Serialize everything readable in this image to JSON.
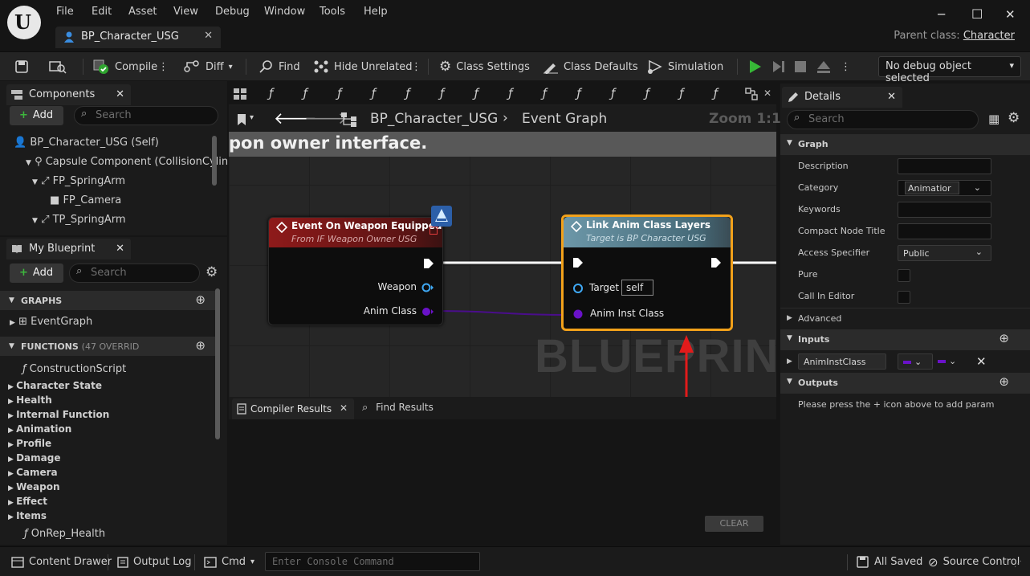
{
  "app": {
    "logo_letter": "U",
    "menu": [
      "File",
      "Edit",
      "Asset",
      "View",
      "Debug",
      "Window",
      "Tools",
      "Help"
    ],
    "tab_title": "BP_Character_USG",
    "parent_class_label": "Parent class:",
    "parent_class_value": "Character"
  },
  "toolbar": {
    "compile": "Compile",
    "diff": "Diff",
    "find": "Find",
    "hide_unrelated": "Hide Unrelated",
    "class_settings": "Class Settings",
    "class_defaults": "Class Defaults",
    "simulation": "Simulation",
    "debug_object": "No debug object selected"
  },
  "components": {
    "title": "Components",
    "add": "Add",
    "search_placeholder": "Search",
    "items": [
      "BP_Character_USG (Self)",
      "Capsule Component (CollisionCylin",
      "FP_SpringArm",
      "FP_Camera",
      "TP_SpringArm"
    ]
  },
  "my_blueprint": {
    "title": "My Blueprint",
    "add": "Add",
    "search_placeholder": "Search",
    "graphs_label": "GRAPHS",
    "event_graph": "EventGraph",
    "functions_label": "FUNCTIONS",
    "functions_overrides": "(47 OVERRID",
    "construction_script": "ConstructionScript",
    "categories": [
      "Character State",
      "Health",
      "Internal Function",
      "Animation",
      "Profile",
      "Damage",
      "Camera",
      "Weapon",
      "Effect",
      "Items"
    ],
    "last_item": "OnRep_Health"
  },
  "graph": {
    "func_glyph": "ƒ",
    "breadcrumb_bp": "BP_Character_USG",
    "breadcrumb_graph": "Event Graph",
    "zoom": "Zoom 1:1",
    "comment": "pon owner interface.",
    "watermark": "BLUEPRINT",
    "node1": {
      "title": "Event On Weapon Equipped",
      "subtitle": "From IF Weapon Owner USG",
      "pin_weapon": "Weapon",
      "pin_anim_class": "Anim Class"
    },
    "node2": {
      "title": "Link Anim Class Layers",
      "subtitle": "Target is BP Character USG",
      "pin_target": "Target",
      "pin_target_value": "self",
      "pin_anim_inst": "Anim Inst Class"
    }
  },
  "results": {
    "tab_compiler": "Compiler Results",
    "tab_find": "Find Results",
    "clear": "CLEAR"
  },
  "details": {
    "title": "Details",
    "search_placeholder": "Search",
    "graph_section": "Graph",
    "rows": {
      "description": "Description",
      "category": "Category",
      "category_value": "Animatior",
      "keywords": "Keywords",
      "compact": "Compact Node Title",
      "access": "Access Specifier",
      "access_value": "Public",
      "pure": "Pure",
      "call_in_editor": "Call In Editor"
    },
    "advanced": "Advanced",
    "inputs": "Inputs",
    "input_name": "AnimInstClass",
    "outputs": "Outputs",
    "outputs_hint": "Please press the + icon above to add parameters"
  },
  "statusbar": {
    "content_drawer": "Content Drawer",
    "output_log": "Output Log",
    "cmd": "Cmd",
    "console_placeholder": "Enter Console Command",
    "all_saved": "All Saved",
    "source_control": "Source Control"
  },
  "colors": {
    "exec_white": "#ffffff",
    "pin_object": "#3fa9f5",
    "pin_class": "#6a12c9",
    "node1_header": "#8e1a1a",
    "node2_header": "#5f8797",
    "selection": "#f2a11a",
    "arrow": "#e21b1b"
  }
}
